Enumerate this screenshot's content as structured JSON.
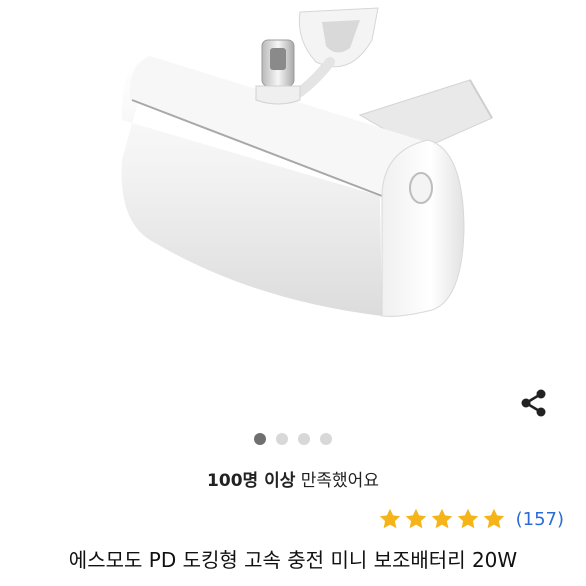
{
  "product": {
    "image_alt": "white docking power bank with USB-C connector",
    "title": "에스모도 PD 도킹형 고속 충전 미니 보조배터리 20W"
  },
  "toolbar": {
    "share_icon": "share-icon"
  },
  "carousel": {
    "total": 4,
    "active_index": 0
  },
  "satisfaction": {
    "strong": "100명 이상",
    "rest": "만족했어요"
  },
  "rating": {
    "stars": 5,
    "max": 5,
    "count": "(157)",
    "star_color": "#f5b418",
    "count_color": "#2d6bd6"
  }
}
